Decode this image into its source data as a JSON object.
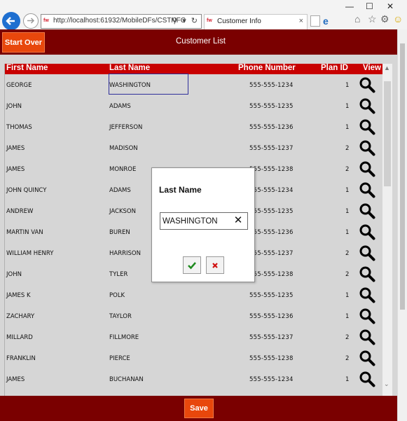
{
  "browser": {
    "url": "http://localhost:61932/MobileDFs/CSTNFC",
    "address_icons": "⚲ ▾ ↻",
    "tab_title": "Customer Info",
    "favicon_text": "fw",
    "close_glyph": "×"
  },
  "header": {
    "start_over_label": "Start Over",
    "title": "Customer List"
  },
  "grid": {
    "columns": {
      "first": "First Name",
      "last": "Last Name",
      "phone": "Phone Number",
      "plan": "Plan ID",
      "view": "View"
    },
    "rows": [
      {
        "first": "GEORGE",
        "last": "WASHINGTON",
        "phone": "555-555-1234",
        "plan": "1"
      },
      {
        "first": "JOHN",
        "last": "ADAMS",
        "phone": "555-555-1235",
        "plan": "1"
      },
      {
        "first": "THOMAS",
        "last": "JEFFERSON",
        "phone": "555-555-1236",
        "plan": "1"
      },
      {
        "first": "JAMES",
        "last": "MADISON",
        "phone": "555-555-1237",
        "plan": "2"
      },
      {
        "first": "JAMES",
        "last": "MONROE",
        "phone": "555-555-1238",
        "plan": "2"
      },
      {
        "first": "JOHN QUINCY",
        "last": "ADAMS",
        "phone": "555-555-1234",
        "plan": "1"
      },
      {
        "first": "ANDREW",
        "last": "JACKSON",
        "phone": "555-555-1235",
        "plan": "1"
      },
      {
        "first": "MARTIN VAN",
        "last": "BUREN",
        "phone": "555-555-1236",
        "plan": "1"
      },
      {
        "first": "WILLIAM HENRY",
        "last": "HARRISON",
        "phone": "555-555-1237",
        "plan": "2"
      },
      {
        "first": "JOHN",
        "last": "TYLER",
        "phone": "555-555-1238",
        "plan": "2"
      },
      {
        "first": "JAMES K",
        "last": "POLK",
        "phone": "555-555-1235",
        "plan": "1"
      },
      {
        "first": "ZACHARY",
        "last": "TAYLOR",
        "phone": "555-555-1236",
        "plan": "1"
      },
      {
        "first": "MILLARD",
        "last": "FILLMORE",
        "phone": "555-555-1237",
        "plan": "2"
      },
      {
        "first": "FRANKLIN",
        "last": "PIERCE",
        "phone": "555-555-1238",
        "plan": "2"
      },
      {
        "first": "JAMES",
        "last": "BUCHANAN",
        "phone": "555-555-1234",
        "plan": "1"
      }
    ]
  },
  "dialog": {
    "title": "Last Name",
    "input_value": "WASHINGTON",
    "clear_glyph": "✕"
  },
  "footer": {
    "save_label": "Save"
  },
  "icons": {
    "view_row": "magnifier-icon",
    "dialog_ok": "checkmark-icon",
    "dialog_cancel": "x-icon",
    "back": "back-arrow-icon",
    "forward": "forward-arrow-icon"
  },
  "colors": {
    "header_bg": "#7a0000",
    "grid_header_bg": "#c80000",
    "button_orange": "#e8470c",
    "grid_bg": "#d6d6d6",
    "ok_green": "#1e8a1e",
    "cancel_red": "#d01010"
  }
}
